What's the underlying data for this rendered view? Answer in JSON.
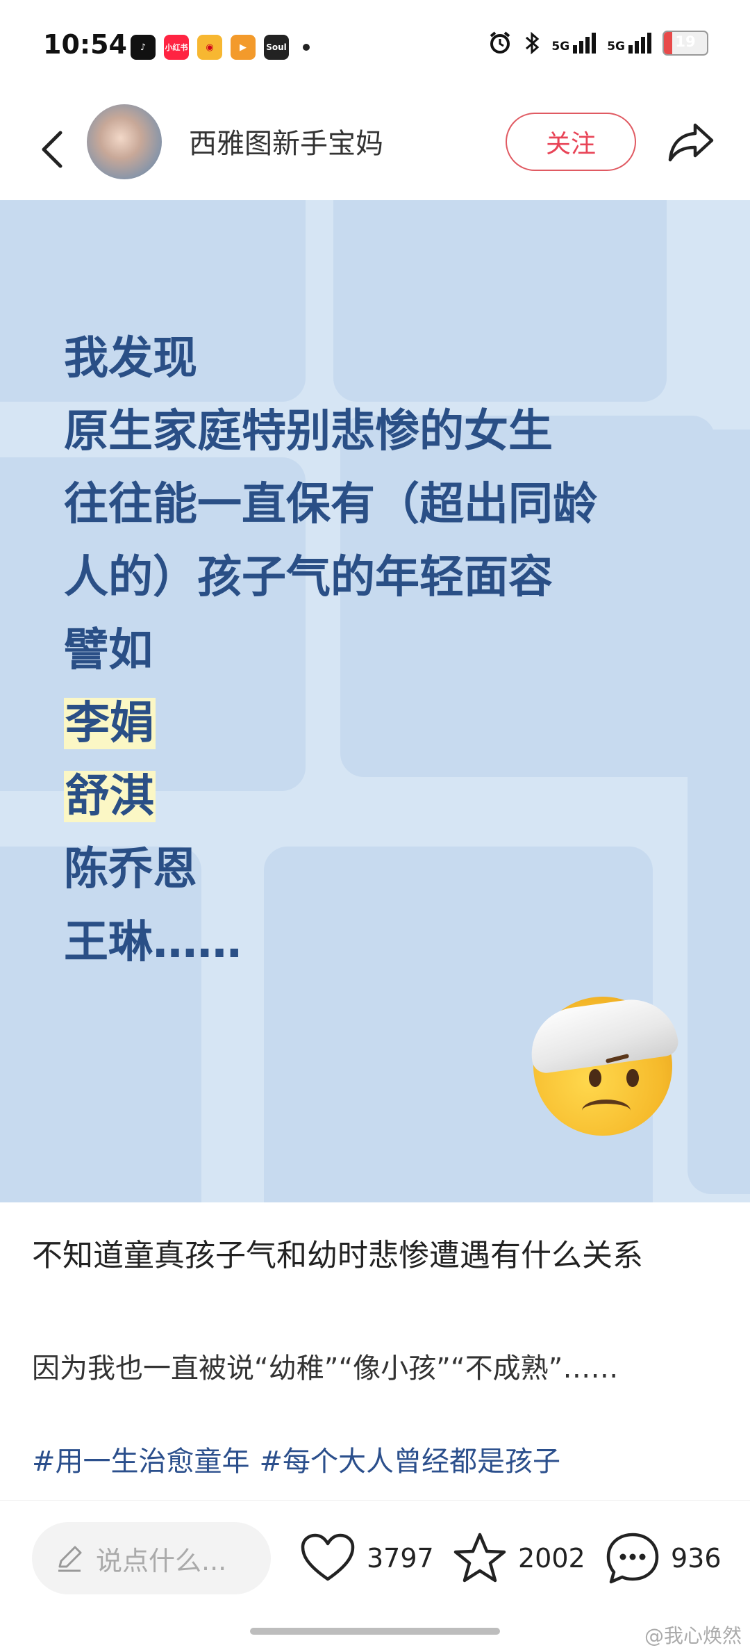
{
  "status_bar": {
    "time": "10:54",
    "apps": [
      "抖音",
      "小红书",
      "微博",
      "优酷",
      "Soul"
    ],
    "network": "5G",
    "battery": {
      "text": "19",
      "level": 0.19
    }
  },
  "header": {
    "author": "西雅图新手宝妈",
    "follow_label": "关注"
  },
  "post_image": {
    "lines": [
      "我发现",
      "原生家庭特别悲惨的女生",
      "往往能一直保有（超出同龄",
      "人的）孩子气的年轻面容",
      "譬如",
      "李娟",
      "舒淇",
      "陈乔恩",
      "王琳……"
    ],
    "highlighted": [
      "李娟",
      "舒淇"
    ],
    "text_color": "#2a4f86",
    "emoji": "bandaged-head-face"
  },
  "post": {
    "title": "不知道童真孩子气和幼时悲惨遭遇有什么关系",
    "description": "因为我也一直被说“幼稚”“像小孩”“不成熟”……",
    "tags": [
      "#用一生治愈童年",
      "#每个大人曾经都是孩子"
    ]
  },
  "bottom_bar": {
    "comment_placeholder": "说点什么...",
    "likes": "3797",
    "favorites": "2002",
    "comments": "936"
  },
  "watermark": "@我心焕然",
  "colors": {
    "accent": "#e84457",
    "tag": "#2b4f8c",
    "image_bg": "#d6e5f4"
  }
}
